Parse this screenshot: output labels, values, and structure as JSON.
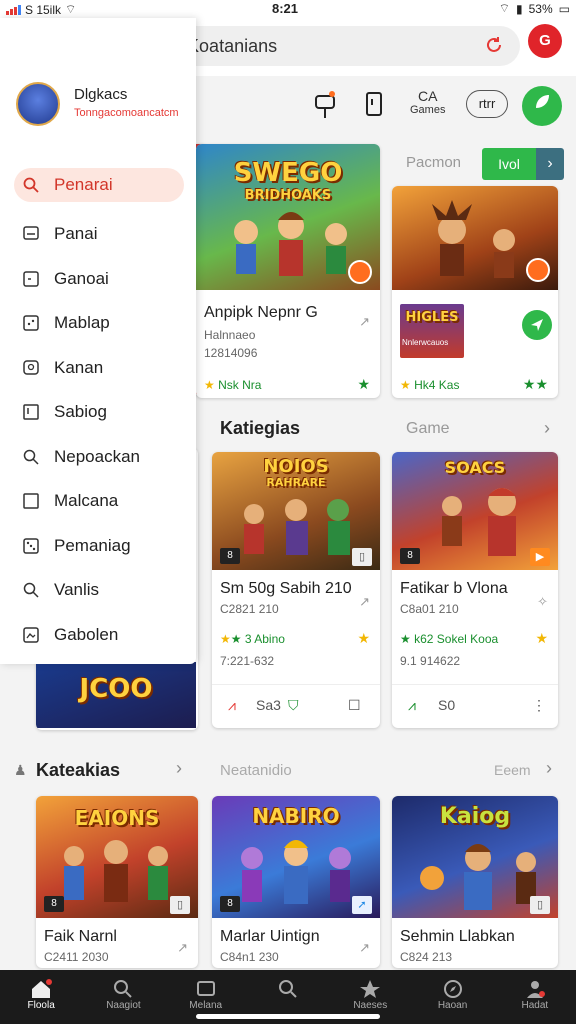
{
  "status_bar": {
    "carrier": "S 15ilk",
    "time": "8:21",
    "battery": "53%"
  },
  "header": {
    "url": "Aplkpolcar Koatanians",
    "profile_letter": "G"
  },
  "toolbar": {
    "games_top": "CA",
    "games_label": "Games",
    "pill_label": "rtrr"
  },
  "drawer": {
    "user_name": "Dlgkacs",
    "user_sub": "Tonngacomoancatcm",
    "items": [
      {
        "label": "Penarai",
        "icon": "search-icon"
      },
      {
        "label": "Panai",
        "icon": "chat-icon"
      },
      {
        "label": "Ganoai",
        "icon": "square-icon"
      },
      {
        "label": "Mablap",
        "icon": "dice-icon"
      },
      {
        "label": "Kanan",
        "icon": "message-icon"
      },
      {
        "label": "Sabiog",
        "icon": "bookmark-icon"
      },
      {
        "label": "Nepoackan",
        "icon": "search-icon"
      },
      {
        "label": "Malcana",
        "icon": "square-icon"
      },
      {
        "label": "Pemaniag",
        "icon": "dice-icon"
      },
      {
        "label": "Vanlis",
        "icon": "search-icon"
      },
      {
        "label": "Gabolen",
        "icon": "image-icon"
      }
    ]
  },
  "top_row": {
    "aux": "Pacmon",
    "button_label": "Ivol",
    "cards": [
      {
        "art_title": "SWEGO",
        "art_sub": "BRIDHOAKS",
        "name": "Anpipk Nepnr G",
        "sub": "Halnnaeo",
        "meta": "12814096",
        "rating": "Nsk Nra"
      },
      {
        "art_title": "",
        "art_sub": "",
        "name": "",
        "sub": "",
        "meta": "",
        "rating": "Hk4 Kas"
      }
    ],
    "mini_title": "HIGLES",
    "mini_sub": "Nnlerwcauos"
  },
  "section1": {
    "title": "Katiegias",
    "aux": "Game",
    "cards": [
      {
        "art_title": "NOIOS",
        "art_sub": "RAHRARE",
        "name": "Sm 50g Sabih 210",
        "sub": "C2821 210",
        "rating": "3 Abino",
        "meta": "7:221-632",
        "foot_label": "Sa3"
      },
      {
        "art_title": "SOACS",
        "art_sub": "",
        "name": "Fatikar b Vlona",
        "sub": "C8a01 210",
        "rating": "k62 Sokel Kooa",
        "meta": "9.1 914622",
        "foot_label": "S0"
      }
    ],
    "left_art_title": "JCOO"
  },
  "section2": {
    "title": "Kateakias",
    "aux": "Neatanidio",
    "aux2": "Eeem",
    "cards": [
      {
        "art_title": "EAIONS",
        "name": "Faik Narnl",
        "sub": "C2411 2030"
      },
      {
        "art_title": "NABIRO",
        "name": "Marlar Uintign",
        "sub": "C84n1 230"
      },
      {
        "art_title": "Kaiog",
        "name": "Sehmin Llabkan",
        "sub": "C824 213"
      }
    ]
  },
  "bottom_nav": [
    {
      "label": "Floola",
      "icon": "home-icon"
    },
    {
      "label": "Naagiot",
      "icon": "search-icon"
    },
    {
      "label": "Melana",
      "icon": "tv-icon"
    },
    {
      "label": "",
      "icon": "search-icon"
    },
    {
      "label": "Naeses",
      "icon": "star-icon"
    },
    {
      "label": "Haoan",
      "icon": "compass-icon"
    },
    {
      "label": "Hadat",
      "icon": "person-icon"
    }
  ],
  "colors": {
    "accent_green": "#2fb84a",
    "accent_red": "#e53935",
    "drawer_active": "#fde6df"
  }
}
